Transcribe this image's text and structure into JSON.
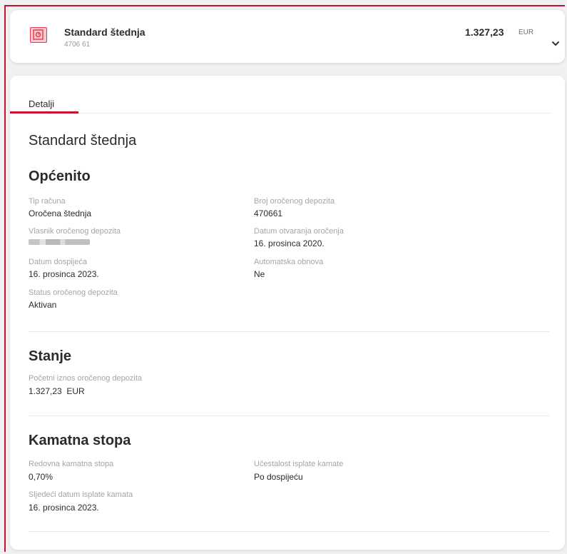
{
  "account": {
    "name": "Standard štednja",
    "number": "4706 61",
    "amount": "1.327,23",
    "currency": "EUR"
  },
  "tabs": {
    "details": "Detalji"
  },
  "page_title": "Standard štednja",
  "sections": {
    "general": {
      "title": "Općenito",
      "account_type_label": "Tip računa",
      "account_type_value": "Oročena štednja",
      "deposit_number_label": "Broj oročenog depozita",
      "deposit_number_value": "470661",
      "owner_label": "Vlasnik oročenog depozita",
      "opening_date_label": "Datum otvaranja oročenja",
      "opening_date_value": "16. prosinca 2020.",
      "maturity_date_label": "Datum dospijeća",
      "maturity_date_value": "16. prosinca 2023.",
      "auto_renewal_label": "Automatska obnova",
      "auto_renewal_value": "Ne",
      "status_label": "Status oročenog depozita",
      "status_value": "Aktivan"
    },
    "balance": {
      "title": "Stanje",
      "initial_amount_label": "Početni iznos oročenog depozita",
      "initial_amount_value": "1.327,23  EUR"
    },
    "interest": {
      "title": "Kamatna stopa",
      "regular_rate_label": "Redovna kamatna stopa",
      "regular_rate_value": "0,70%",
      "payout_frequency_label": "Učestalost isplate kamate",
      "payout_frequency_value": "Po dospijeću",
      "next_payout_label": "Sljedeći datum isplate kamata",
      "next_payout_value": "16. prosinca 2023."
    }
  },
  "colors": {
    "accent": "#c8102e",
    "icon_fill": "#f7c9cf"
  },
  "icons": {
    "account": "safe-icon",
    "expand": "chevron-down-icon"
  }
}
